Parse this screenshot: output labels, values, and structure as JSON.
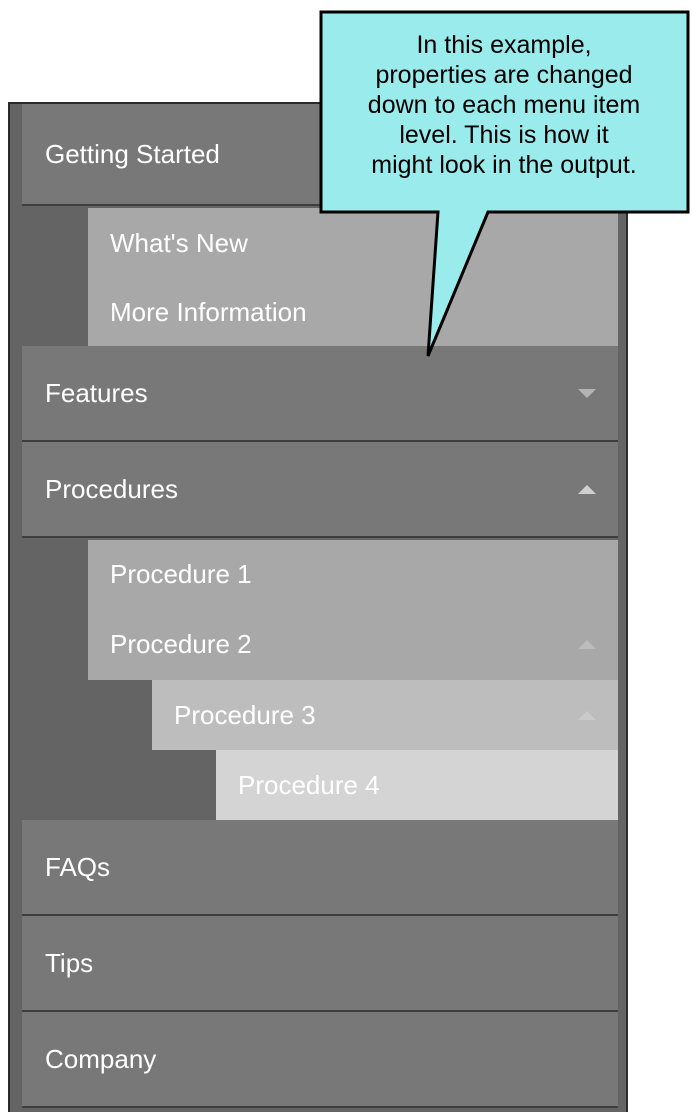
{
  "menu": {
    "items": [
      {
        "label": "Getting Started"
      },
      {
        "label": "What's New"
      },
      {
        "label": "More Information"
      },
      {
        "label": "Features"
      },
      {
        "label": "Procedures"
      },
      {
        "label": "Procedure 1"
      },
      {
        "label": "Procedure 2"
      },
      {
        "label": "Procedure 3"
      },
      {
        "label": "Procedure 4"
      },
      {
        "label": "FAQs"
      },
      {
        "label": "Tips"
      },
      {
        "label": "Company"
      }
    ],
    "expand_icon": "triangle-down-icon",
    "collapse_icon": "triangle-up-icon"
  },
  "callout": {
    "lines": [
      "In this example,",
      "properties are changed",
      "down to each menu item",
      "level. This is how it",
      "might look in the output."
    ],
    "fill_color": "#99ebec",
    "border_color": "#000000"
  },
  "colors": {
    "level1": "#787878",
    "level2": "#a8a8a8",
    "level3": "#bdbdbd",
    "level4": "#d4d4d4",
    "menu_background": "#646464"
  }
}
